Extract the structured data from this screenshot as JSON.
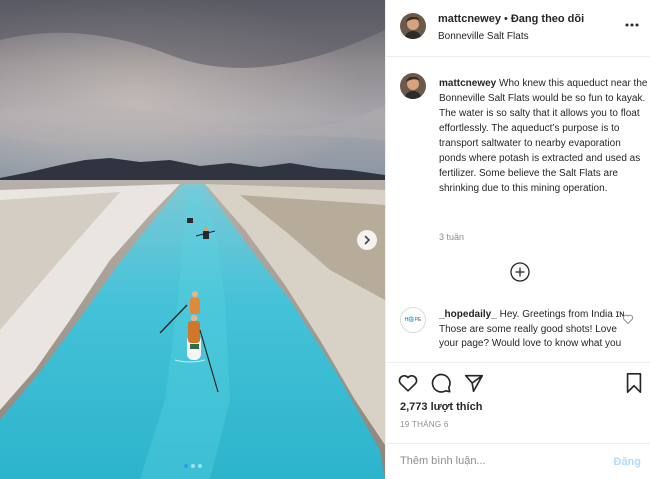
{
  "post": {
    "username": "mattcnewey",
    "follow_status": "Đang theo dõi",
    "location": "Bonneville Salt Flats",
    "caption": "Who knew this aqueduct near the Bonneville Salt Flats would be so fun to kayak. The water is so salty that it allows you to float effortlessly. The aqueduct’s purpose is to transport saltwater to nearby evaporation ponds where potash is extracted and used as fertilizer. Some believe the Salt Flats are shrinking due to this mining operation.",
    "caption_time": "3 tuần",
    "likes": "2,773 lượt thích",
    "date": "19 THÁNG 6"
  },
  "comments": [
    {
      "username": "_hopedaily_",
      "avatar_text": "H🌐PE",
      "text": "Hey. Greetings from India ɪɴ Those are some really good shots! Love your page? Would love to know what you"
    }
  ],
  "comment_box": {
    "placeholder": "Thêm bình luận...",
    "post_label": "Đăng"
  },
  "carousel": {
    "total": 3,
    "active": 1
  },
  "colors": {
    "link_blue": "#3897f0",
    "post_button_disabled": "#b3dbff",
    "muted_text": "#8e8e8e",
    "water": "#3fc3d6"
  },
  "icons": [
    "more-options-icon",
    "next-arrow-icon",
    "load-more-icon",
    "heart-icon",
    "comment-icon",
    "share-icon",
    "bookmark-icon"
  ]
}
